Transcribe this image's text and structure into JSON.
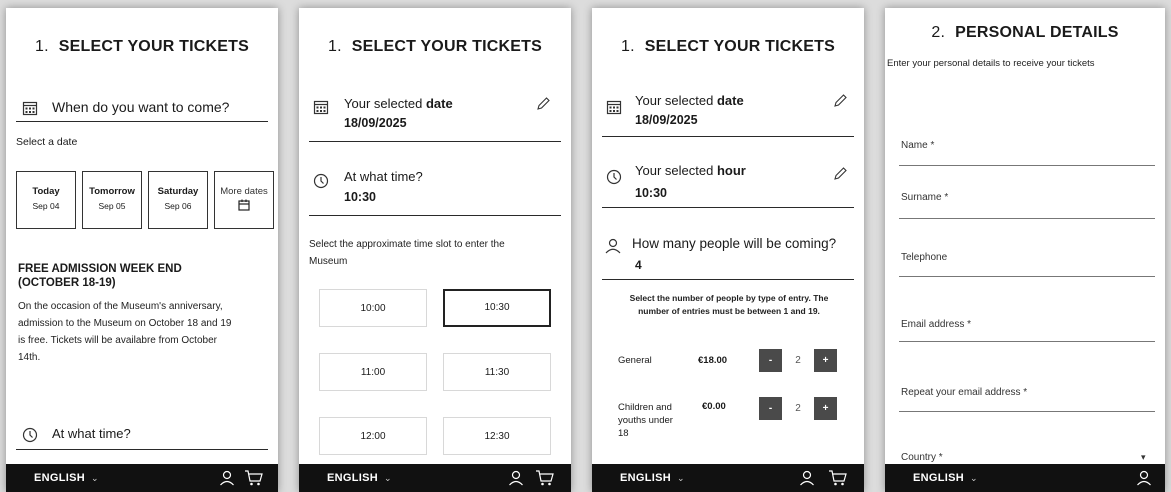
{
  "footer": {
    "language": "ENGLISH"
  },
  "screen1": {
    "step_num": "1.",
    "step_title": "SELECT YOUR TICKETS",
    "question": "When do you want to come?",
    "select_date": "Select a date",
    "days": [
      {
        "day": "Today",
        "date": "Sep 04"
      },
      {
        "day": "Tomorrow",
        "date": "Sep 05"
      },
      {
        "day": "Saturday",
        "date": "Sep 06"
      }
    ],
    "more_dates": "More dates",
    "notice_title_1": "FREE ADMISSION WEEK END",
    "notice_title_2": "(OCTOBER 18-19)",
    "notice_body_1": "On the occasion of the Museum's anniversary,",
    "notice_body_2": "admission to the Museum on October 18 and 19",
    "notice_body_3": "is free. Tickets will be availabre from October",
    "notice_body_4": "14th.",
    "time_question": "At what time?"
  },
  "screen2": {
    "step_num": "1.",
    "step_title": "SELECT YOUR TICKETS",
    "selected_label": "Your selected",
    "selected_label_bold": "date",
    "selected_date": "18/09/2025",
    "time_question": "At what time?",
    "selected_time": "10:30",
    "instruction_1": "Select the approximate time slot to enter the",
    "instruction_2": "Museum",
    "slots": [
      "10:00",
      "10:30",
      "11:00",
      "11:30",
      "12:00",
      "12:30"
    ],
    "selected_slot": "10:30"
  },
  "screen3": {
    "step_num": "1.",
    "step_title": "SELECT YOUR TICKETS",
    "selected_label": "Your selected",
    "selected_label_bold": "date",
    "selected_date": "18/09/2025",
    "hour_label": "Your selected",
    "hour_label_bold": "hour",
    "selected_hour": "10:30",
    "people_question": "How many people will be coming?",
    "people_count": "4",
    "instruction_1": "Select the number of people by type of entry. The",
    "instruction_2": "number of entries must be between 1 and 19.",
    "tickets": [
      {
        "name_1": "General",
        "name_2": "",
        "name_3": "",
        "price": "€18.00",
        "qty": "2"
      },
      {
        "name_1": "Children and",
        "name_2": "youths under",
        "name_3": "18",
        "price": "€0.00",
        "qty": "2"
      }
    ],
    "minus": "-",
    "plus": "+"
  },
  "screen4": {
    "step_num": "2.",
    "step_title": "PERSONAL DETAILS",
    "intro": "Enter your personal details to receive your tickets",
    "fields": [
      "Name *",
      "Surname *",
      "Telephone",
      "Email address *",
      "Repeat your email address *",
      "Country *"
    ]
  },
  "colors": {
    "footer_bg": "#111111",
    "stepper_bg": "#4a4a4a"
  }
}
